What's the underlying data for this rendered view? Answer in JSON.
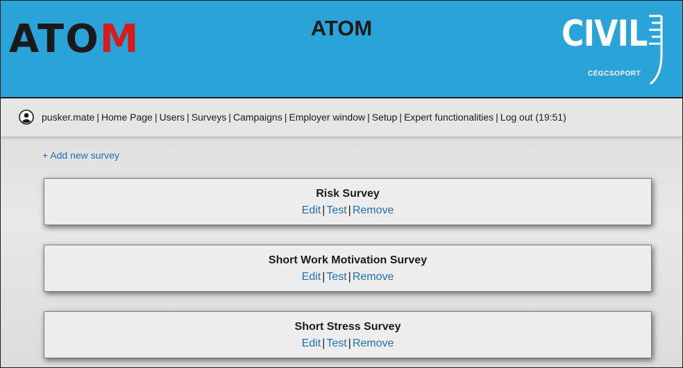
{
  "header": {
    "logo_text_left": "ATOM",
    "title": "ATOM",
    "logo_text_right": "CIVIL",
    "logo_sub_right": "CÉGCSOPORT",
    "background_color": "#2aa4d8"
  },
  "nav": {
    "user_icon": "user-avatar-icon",
    "username": "pusker.mate",
    "items": [
      {
        "label": "Home Page"
      },
      {
        "label": "Users"
      },
      {
        "label": "Surveys"
      },
      {
        "label": "Campaigns"
      },
      {
        "label": "Employer window"
      },
      {
        "label": "Setup"
      },
      {
        "label": "Expert functionalities"
      },
      {
        "label": "Log out (19:51)"
      }
    ],
    "separator": "|"
  },
  "add_survey_label": "+ Add new survey",
  "surveys": [
    {
      "title": "Risk Survey",
      "edit": "Edit",
      "test": "Test",
      "remove": "Remove"
    },
    {
      "title": "Short Work Motivation Survey",
      "edit": "Edit",
      "test": "Test",
      "remove": "Remove"
    },
    {
      "title": "Short Stress Survey",
      "edit": "Edit",
      "test": "Test",
      "remove": "Remove"
    }
  ],
  "colors": {
    "link": "#1f6fb5",
    "header": "#2aa4d8",
    "atom_dot": "#d21e1e"
  }
}
